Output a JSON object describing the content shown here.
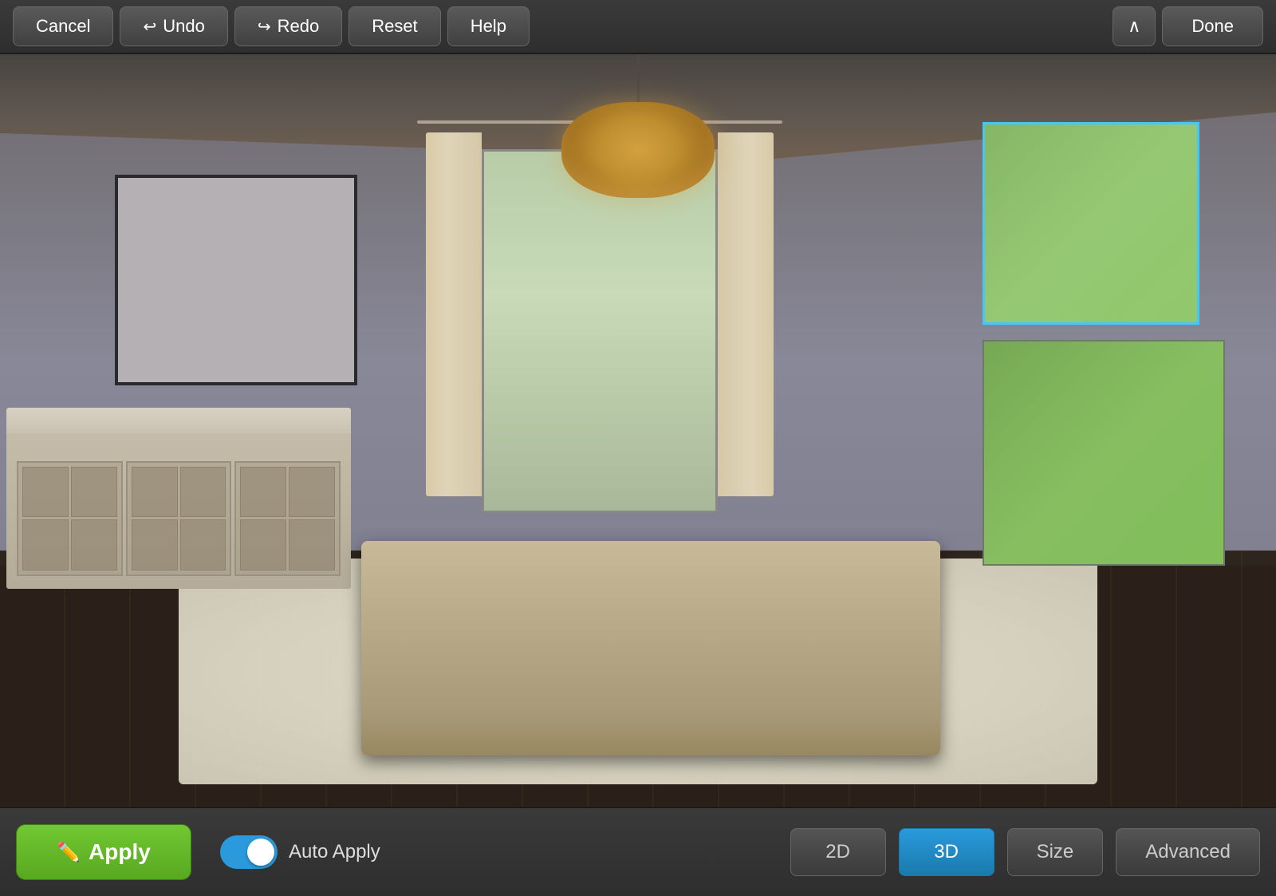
{
  "toolbar": {
    "cancel_label": "Cancel",
    "undo_label": "Undo",
    "redo_label": "Redo",
    "reset_label": "Reset",
    "help_label": "Help",
    "done_label": "Done",
    "chevron_label": "^"
  },
  "bottom_bar": {
    "apply_label": "Apply",
    "auto_apply_label": "Auto Apply",
    "view_2d_label": "2D",
    "view_3d_label": "3D",
    "size_label": "Size",
    "advanced_label": "Advanced",
    "toggle_on": true,
    "active_view": "3D"
  },
  "scene": {
    "description": "Dining room interior with chandelier, dining table set, sideboard, windows with curtains"
  }
}
